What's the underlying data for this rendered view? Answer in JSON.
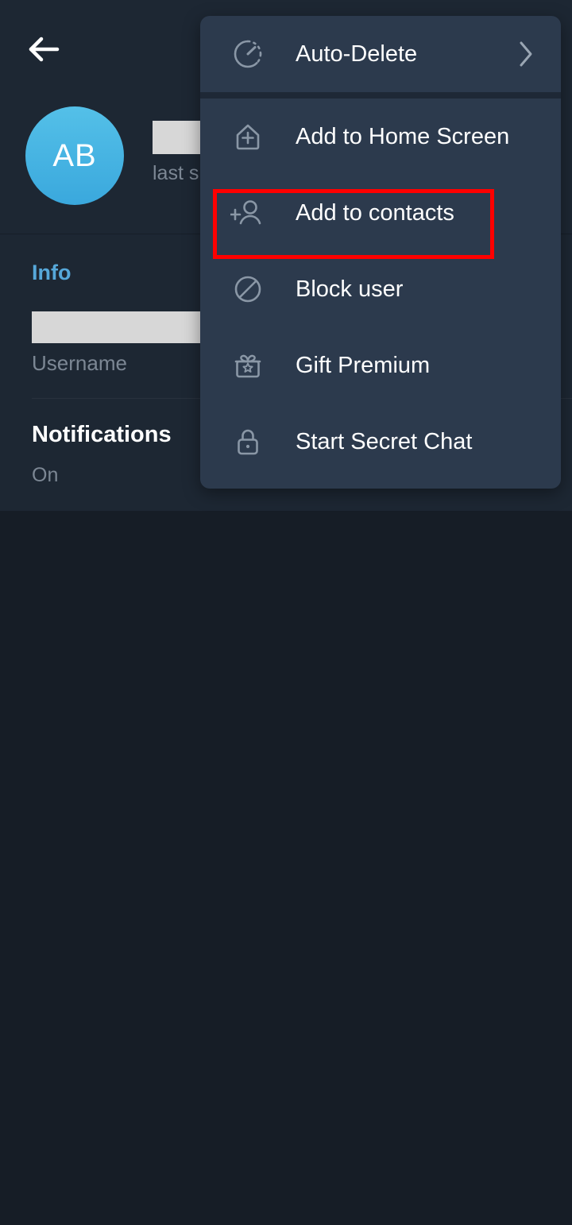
{
  "theme": {
    "page_bg": "#161d26",
    "panel_bg": "#1d2733",
    "menu_bg": "#2c3a4d",
    "accent_blue": "#56a8da",
    "avatar_blue": "#3aa8dd",
    "highlight_red": "#ff0000",
    "text_primary": "#ffffff",
    "text_secondary": "#7c8794"
  },
  "header": {
    "back_icon": "back-arrow-icon",
    "avatar_initials": "AB",
    "name_redacted": true,
    "status": "last s"
  },
  "info": {
    "section_title": "Info",
    "username_value_redacted": true,
    "username_label": "Username",
    "notifications_title": "Notifications",
    "notifications_value": "On"
  },
  "menu": {
    "items": [
      {
        "label": "Auto-Delete",
        "icon": "timer-icon",
        "chevron": true,
        "highlighted": false
      },
      {
        "label": "Add to Home Screen",
        "icon": "home-plus-icon",
        "chevron": false,
        "highlighted": false
      },
      {
        "label": "Add to contacts",
        "icon": "person-plus-icon",
        "chevron": false,
        "highlighted": true
      },
      {
        "label": "Block user",
        "icon": "block-icon",
        "chevron": false,
        "highlighted": false
      },
      {
        "label": "Gift Premium",
        "icon": "gift-icon",
        "chevron": false,
        "highlighted": false
      },
      {
        "label": "Start Secret Chat",
        "icon": "lock-icon",
        "chevron": false,
        "highlighted": false
      }
    ],
    "separator_after_index": 0
  }
}
